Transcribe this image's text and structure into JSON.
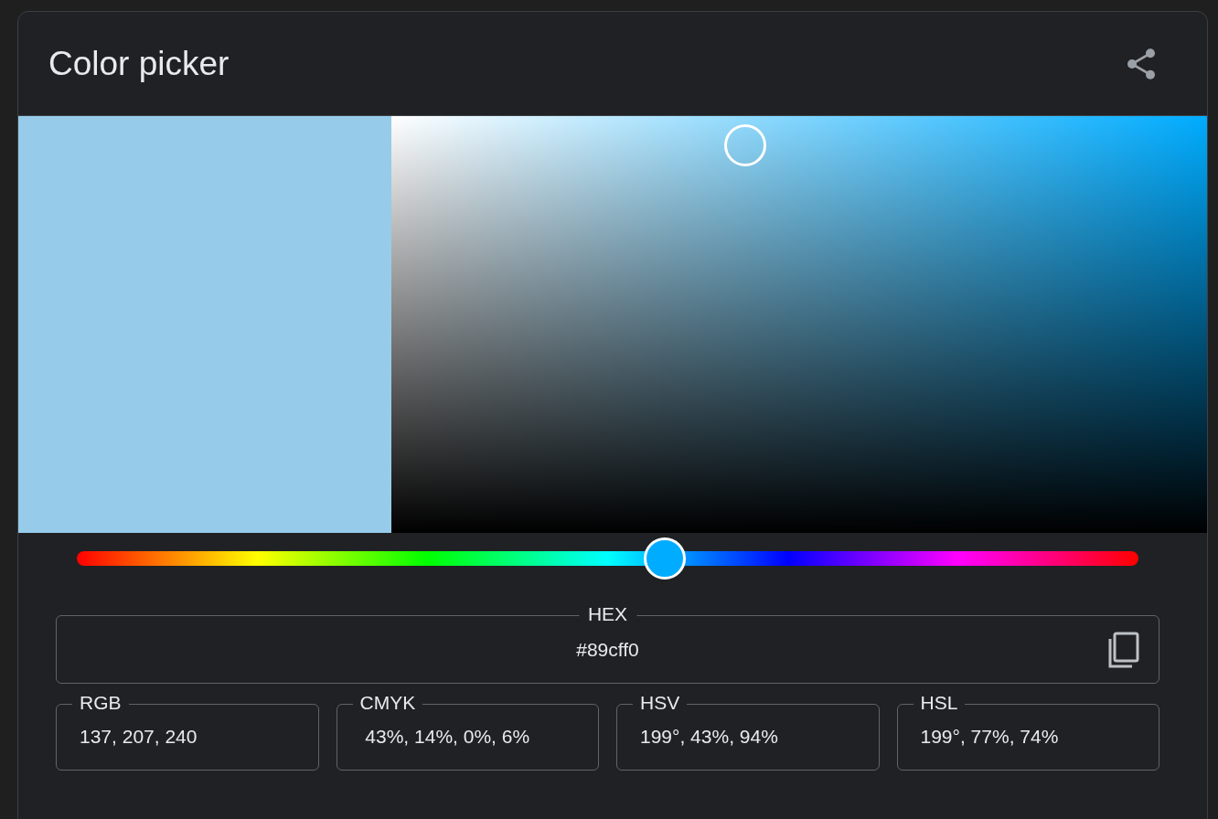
{
  "title": "Color picker",
  "swatch": {
    "color": "#96cbea"
  },
  "picker": {
    "saturation": {
      "level": 0.434
    }
  },
  "hue_slider": {
    "level": 0.554
  },
  "hex": {
    "label": "HEX",
    "value": "#89cff0"
  },
  "formats": [
    {
      "label": "RGB",
      "value": "137, 207, 240"
    },
    {
      "label": "CMYK",
      "value": " 43%, 14%, 0%, 6%"
    },
    {
      "label": "HSV",
      "value": "199°, 43%, 94%"
    },
    {
      "label": "HSL",
      "value": "199°, 77%, 74%"
    }
  ]
}
